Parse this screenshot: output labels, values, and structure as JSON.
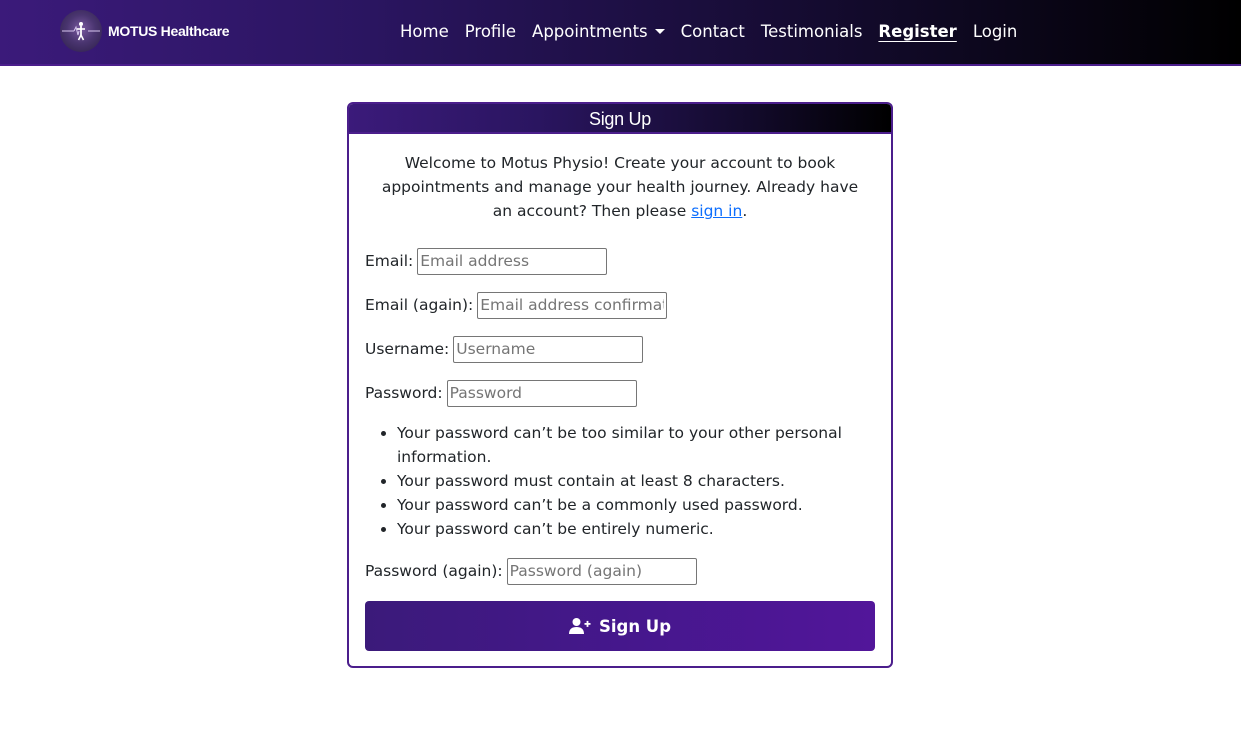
{
  "brand": {
    "name": "MOTUS Healthcare"
  },
  "nav": {
    "items": [
      {
        "label": "Home"
      },
      {
        "label": "Profile"
      },
      {
        "label": "Appointments"
      },
      {
        "label": "Contact"
      },
      {
        "label": "Testimonials"
      },
      {
        "label": "Register",
        "active": true
      },
      {
        "label": "Login"
      }
    ]
  },
  "card": {
    "title": "Sign Up",
    "intro_text": "Welcome to Motus Physio! Create your account to book appointments and manage your health journey. Already have an account? Then please ",
    "intro_link": "sign in",
    "intro_end": "."
  },
  "form": {
    "email": {
      "label": "Email:",
      "value": "",
      "placeholder": "Email address"
    },
    "email_again": {
      "label": "Email (again):",
      "value": "",
      "placeholder": "Email address confirmation"
    },
    "username": {
      "label": "Username:",
      "value": "",
      "placeholder": "Username"
    },
    "password": {
      "label": "Password:",
      "value": "",
      "placeholder": "Password"
    },
    "password_help": [
      "Your password can’t be too similar to your other personal information.",
      "Your password must contain at least 8 characters.",
      "Your password can’t be a commonly used password.",
      "Your password can’t be entirely numeric."
    ],
    "password_again": {
      "label": "Password (again):",
      "value": "",
      "placeholder": "Password (again)"
    },
    "submit_label": "Sign Up",
    "submit_icon": "user-plus-icon"
  },
  "colors": {
    "brand_purple": "#4b1e8c",
    "link_blue": "#0d6efd",
    "nav_gradient_start": "#3b1a7a",
    "nav_gradient_end": "#000000"
  }
}
